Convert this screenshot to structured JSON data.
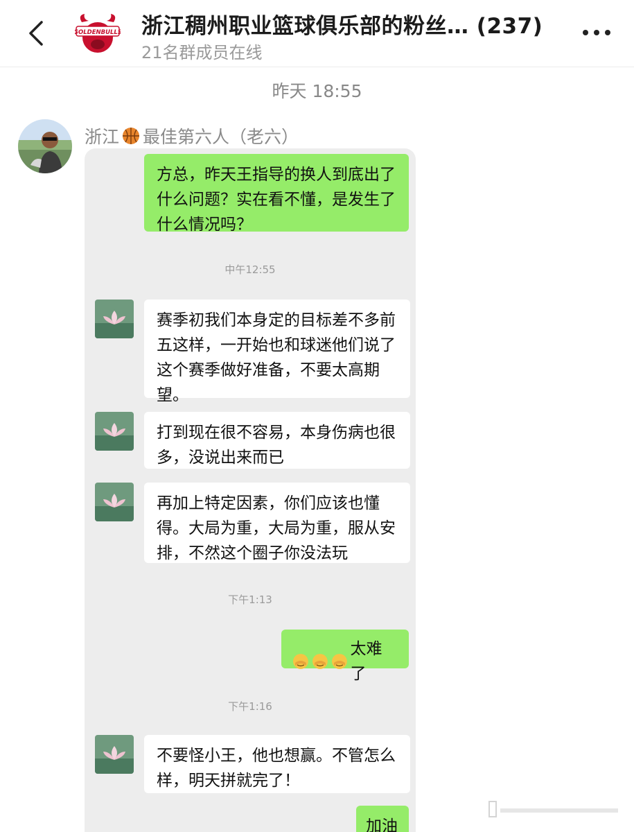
{
  "header": {
    "title": "浙江稠州职业篮球俱乐部的粉丝… (237)",
    "subtitle": "21名群成员在线",
    "logo_text": "GOLDENBULLS"
  },
  "feed_time": "昨天 18:55",
  "author": {
    "name_prefix": "浙江",
    "name_suffix": "最佳第六人（老六）"
  },
  "chat": {
    "messages": [
      {
        "side": "right",
        "text": "方总，昨天王指导的换人到底出了什么问题？实在看不懂，是发生了什么情况吗？"
      },
      {
        "type": "time",
        "text": "中午12:55"
      },
      {
        "side": "left",
        "text": "赛季初我们本身定的目标差不多前五这样，一开始也和球迷他们说了这个赛季做好准备，不要太高期望。"
      },
      {
        "side": "left",
        "text": "打到现在很不容易，本身伤病也很多，没说出来而已"
      },
      {
        "side": "left",
        "text": "再加上特定因素，你们应该也懂得。大局为重，大局为重，服从安排，不然这个圈子你没法玩"
      },
      {
        "type": "time",
        "text": "下午1:13"
      },
      {
        "side": "right",
        "text": "太难了",
        "emoji": [
          "facepalm-emoji",
          "facepalm-emoji",
          "facepalm-emoji"
        ]
      },
      {
        "type": "time",
        "text": "下午1:16"
      },
      {
        "side": "left",
        "text": "不要怪小王，他也想赢。不管怎么样，明天拼就完了！"
      },
      {
        "side": "right",
        "text": "加油"
      }
    ]
  },
  "icons": {
    "back": "chevron-left-icon",
    "more": "more-dots-icon",
    "basketball": "basketball-icon"
  },
  "colors": {
    "right_bubble": "#95ec69",
    "left_bubble": "#ffffff",
    "chat_bg": "#ededed",
    "logo_red": "#c8102e"
  }
}
